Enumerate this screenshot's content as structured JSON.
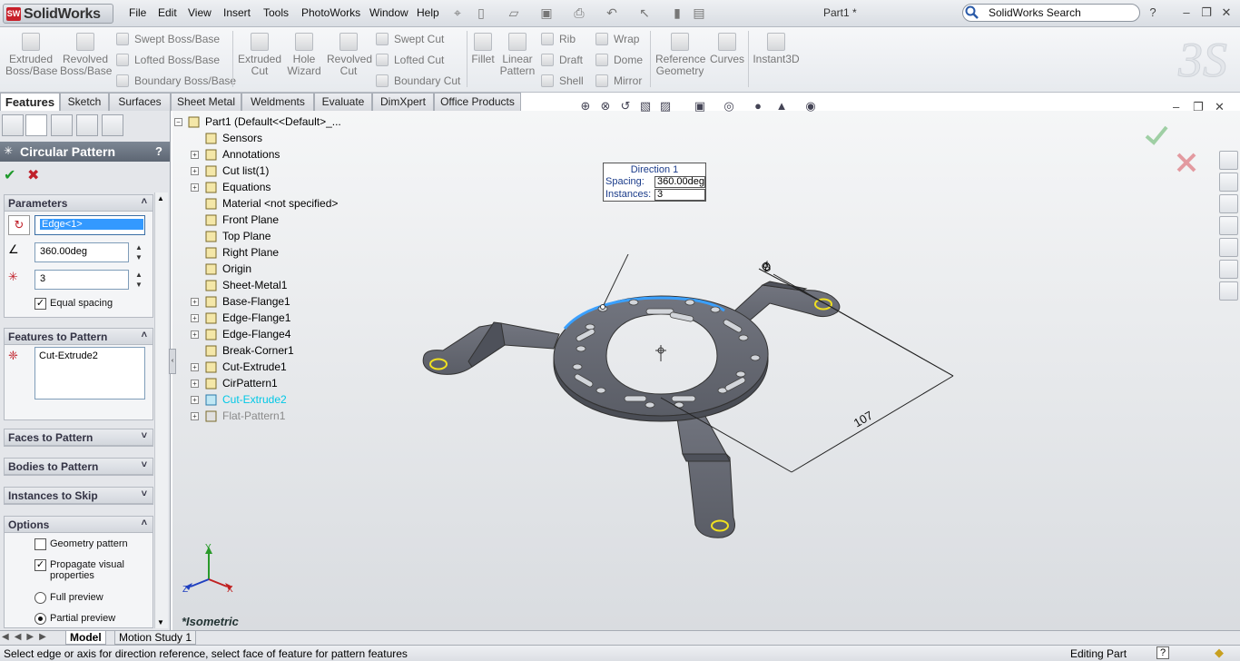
{
  "app": {
    "logo_text": "SolidWorks",
    "logo_badge": "SW",
    "doc_title": "Part1 *"
  },
  "menu": [
    "File",
    "Edit",
    "View",
    "Insert",
    "Tools",
    "PhotoWorks",
    "Window",
    "Help"
  ],
  "search": {
    "placeholder": "SolidWorks Search"
  },
  "commands": {
    "extruded_boss": "Extruded Boss/Base",
    "revolved_boss": "Revolved Boss/Base",
    "swept_boss": "Swept Boss/Base",
    "lofted_boss": "Lofted Boss/Base",
    "boundary_boss": "Boundary Boss/Base",
    "extruded_cut": "Extruded Cut",
    "hole_wizard": "Hole Wizard",
    "revolved_cut": "Revolved Cut",
    "swept_cut": "Swept Cut",
    "lofted_cut": "Lofted Cut",
    "boundary_cut": "Boundary Cut",
    "fillet": "Fillet",
    "linear_pattern": "Linear Pattern",
    "rib": "Rib",
    "draft": "Draft",
    "shell": "Shell",
    "wrap": "Wrap",
    "dome": "Dome",
    "mirror": "Mirror",
    "reference_geometry": "Reference Geometry",
    "curves": "Curves",
    "instant3d": "Instant3D"
  },
  "tabs": [
    "Features",
    "Sketch",
    "Surfaces",
    "Sheet Metal",
    "Weldments",
    "Evaluate",
    "DimXpert",
    "Office Products"
  ],
  "property_manager": {
    "title": "Circular Pattern",
    "help": "?",
    "parameters": {
      "header": "Parameters",
      "direction_edge": "Edge<1>",
      "angle": "360.00deg",
      "instances": "3",
      "equal_spacing": "Equal spacing"
    },
    "features_to_pattern": {
      "header": "Features to Pattern",
      "items": [
        "Cut-Extrude2"
      ]
    },
    "faces_to_pattern": "Faces to Pattern",
    "bodies_to_pattern": "Bodies to Pattern",
    "instances_to_skip": "Instances to Skip",
    "options": {
      "header": "Options",
      "geometry_pattern": "Geometry pattern",
      "propagate": "Propagate visual properties",
      "full_preview": "Full preview",
      "partial_preview": "Partial preview"
    }
  },
  "tree": [
    {
      "label": "Part1  (Default<<Default>_...",
      "color": "#000000"
    },
    {
      "label": "Sensors",
      "color": "#000000"
    },
    {
      "label": "Annotations",
      "color": "#000000"
    },
    {
      "label": "Cut list(1)",
      "color": "#000000"
    },
    {
      "label": "Equations",
      "color": "#000000"
    },
    {
      "label": "Material <not specified>",
      "color": "#000000"
    },
    {
      "label": "Front Plane",
      "color": "#000000"
    },
    {
      "label": "Top Plane",
      "color": "#000000"
    },
    {
      "label": "Right Plane",
      "color": "#000000"
    },
    {
      "label": "Origin",
      "color": "#000000"
    },
    {
      "label": "Sheet-Metal1",
      "color": "#000000"
    },
    {
      "label": "Base-Flange1",
      "color": "#000000"
    },
    {
      "label": "Edge-Flange1",
      "color": "#000000"
    },
    {
      "label": "Edge-Flange4",
      "color": "#000000"
    },
    {
      "label": "Break-Corner1",
      "color": "#000000"
    },
    {
      "label": "Cut-Extrude1",
      "color": "#000000"
    },
    {
      "label": "CirPattern1",
      "color": "#000000"
    },
    {
      "label": "Cut-Extrude2",
      "color": "#00c8e6"
    },
    {
      "label": "Flat-Pattern1",
      "color": "#8a8a8a"
    }
  ],
  "callout": {
    "title": "Direction 1",
    "spacing_label": "Spacing:",
    "spacing_value": "360.00deg",
    "instances_label": "Instances:",
    "instances_value": "3"
  },
  "dimensions": {
    "small": "8",
    "large": "107"
  },
  "view_label": "*Isometric",
  "axes": {
    "x": "X",
    "y": "Y",
    "z": "Z"
  },
  "bottom_tabs": [
    "Model",
    "Motion Study 1"
  ],
  "status": {
    "message": "Select edge or axis for direction reference, select face of feature for pattern features",
    "mode": "Editing Part",
    "help": "?"
  },
  "colors": {
    "accent": "#3399ff",
    "ok": "#1f9a2c",
    "cancel": "#c0202a",
    "part": "#6b6e78",
    "highlight_edge": "#3aa0ff"
  }
}
